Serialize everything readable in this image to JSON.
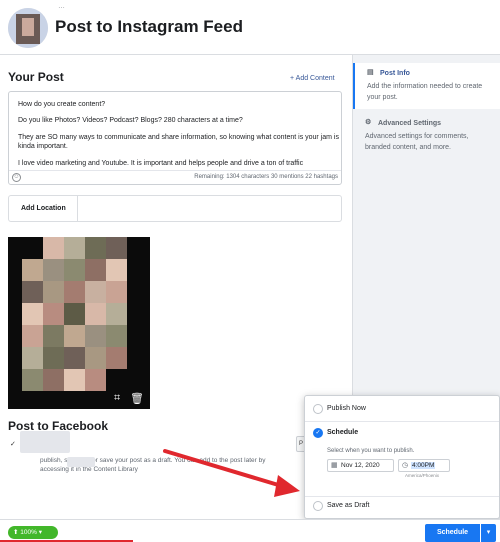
{
  "header": {
    "account_name": "…",
    "title": "Post to Instagram Feed"
  },
  "your_post": {
    "heading": "Your Post",
    "add_content": "+ Add Content",
    "text_lines": [
      "How do you create content?",
      "Do you like Photos? Videos? Podcast? Blogs? 280 characters at a time?",
      "They are SO many ways to communicate and share information, so knowing what content is your jam is kinda important.",
      "I love video marketing and Youtube. It is important and helps people and drive a ton of traffic"
    ],
    "remaining": "Remaining: 1304 characters 30 mentions 22 hashtags"
  },
  "location": {
    "label": "Add Location"
  },
  "media": {
    "tools": [
      "crop-icon",
      "trash-icon"
    ]
  },
  "facebook": {
    "heading": "Post to Facebook",
    "checkmark": "✓",
    "btn_label": "P",
    "line1": "publish, schedule or save your post as a draft. You can add to the post later by",
    "line2": "accessing it in the Content Library"
  },
  "right_panel": {
    "post_info": {
      "title": "Post Info",
      "desc": "Add the information needed to create your post."
    },
    "advanced": {
      "title": "Advanced Settings",
      "desc": "Advanced settings for comments, branded content, and more."
    }
  },
  "publish_options": {
    "publish_now": "Publish Now",
    "schedule": "Schedule",
    "schedule_hint": "Select when you want to publish.",
    "date": "Nov 12, 2020",
    "time": "4:00PM",
    "timezone": "America/Phoenix",
    "draft": "Save as Draft"
  },
  "footer": {
    "zoom": "100%",
    "schedule_button": "Schedule",
    "dropdown": "▾"
  },
  "colors": {
    "accent": "#1877f2",
    "arrow": "#e0282e",
    "zoom_badge": "#42b72a"
  }
}
